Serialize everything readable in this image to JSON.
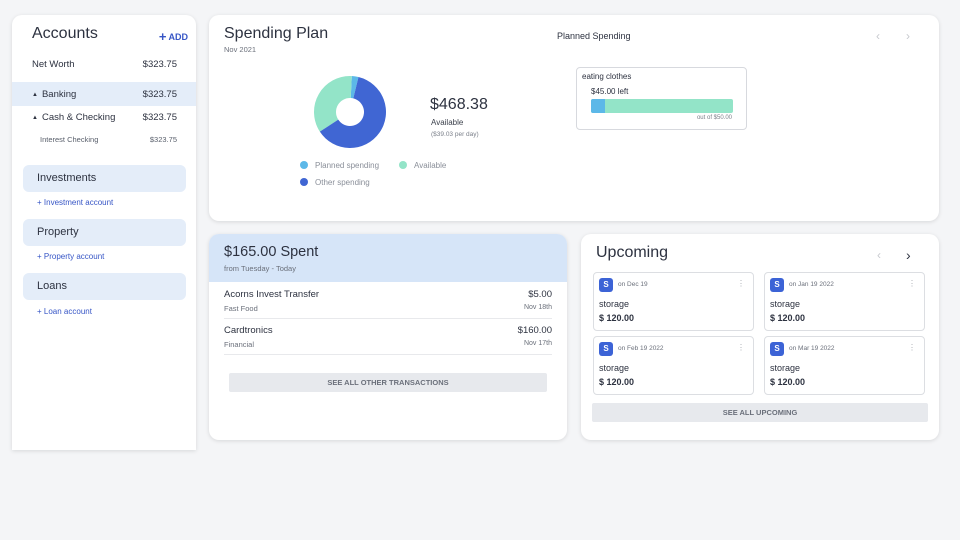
{
  "sidebar": {
    "title": "Accounts",
    "add_label": "ADD",
    "net_worth": {
      "label": "Net Worth",
      "value": "$323.75"
    },
    "banking": {
      "label": "Banking",
      "value": "$323.75"
    },
    "cash_checking": {
      "label": "Cash & Checking",
      "value": "$323.75"
    },
    "interest_checking": {
      "label": "Interest Checking",
      "value": "$323.75"
    },
    "groups": [
      {
        "label": "Investments",
        "link": "+ Investment account"
      },
      {
        "label": "Property",
        "link": "+ Property account"
      },
      {
        "label": "Loans",
        "link": "+ Loan account"
      }
    ]
  },
  "plan": {
    "title": "Spending Plan",
    "month": "Nov 2021",
    "planned_spending_title": "Planned Spending",
    "available_amount": "$468.38",
    "available_label": "Available",
    "per_day": "($39.03 per day)",
    "donut": {
      "planned": 0.03,
      "available": 0.35,
      "other": 0.62
    },
    "legend": {
      "planned": "Planned spending",
      "available": "Available",
      "other": "Other spending"
    },
    "colors": {
      "planned": "#5cb8e8",
      "available": "#93e4c8",
      "other": "#4066d3"
    },
    "budget": {
      "name": "eating clothes",
      "left": "$45.00 left",
      "of": "out of $50.00",
      "spent_fraction": 0.1
    }
  },
  "spent": {
    "title": "$165.00 Spent",
    "subtitle": "from Tuesday - Today",
    "transactions": [
      {
        "name": "Acorns Invest Transfer",
        "category": "Fast Food",
        "amount": "$5.00",
        "date": "Nov 18th"
      },
      {
        "name": "Cardtronics",
        "category": "Financial",
        "amount": "$160.00",
        "date": "Nov 17th"
      }
    ],
    "see_all": "SEE ALL OTHER TRANSACTIONS"
  },
  "upcoming": {
    "title": "Upcoming",
    "items": [
      {
        "badge": "S",
        "date": "on Dec 19",
        "name": "storage",
        "amount": "$ 120.00"
      },
      {
        "badge": "S",
        "date": "on Jan 19 2022",
        "name": "storage",
        "amount": "$ 120.00"
      },
      {
        "badge": "S",
        "date": "on Feb 19 2022",
        "name": "storage",
        "amount": "$ 120.00"
      },
      {
        "badge": "S",
        "date": "on Mar 19 2022",
        "name": "storage",
        "amount": "$ 120.00"
      }
    ],
    "see_all": "SEE ALL UPCOMING"
  }
}
